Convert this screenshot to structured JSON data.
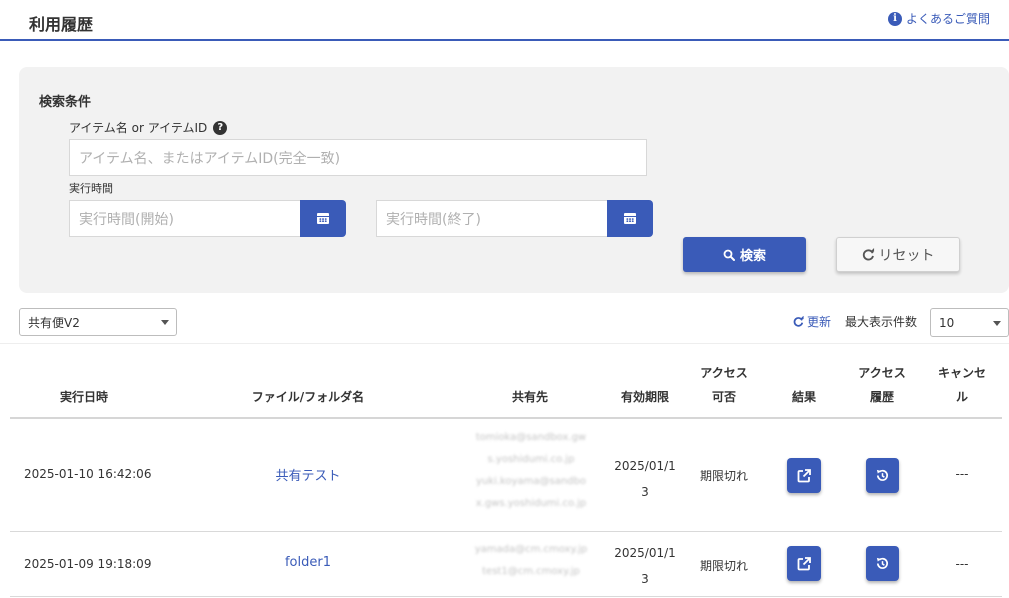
{
  "header": {
    "title": "利用履歴",
    "faq_label": "よくあるご質問"
  },
  "search": {
    "heading": "検索条件",
    "item_label": "アイテム名 or アイテムID",
    "item_placeholder": "アイテム名、またはアイテムID(完全一致)",
    "time_label": "実行時間",
    "start_placeholder": "実行時間(開始)",
    "end_placeholder": "実行時間(終了)",
    "search_button": "検索",
    "reset_button": "リセット"
  },
  "toolbar": {
    "filter_value": "共有便V2",
    "refresh_label": "更新",
    "max_label": "最大表示件数",
    "max_value": "10"
  },
  "table": {
    "headers": {
      "executed_at": "実行日時",
      "name": "ファイル/フォルダ名",
      "share_to": "共有先",
      "expiry": "有効期限",
      "access_1": "アクセス",
      "access_2": "可否",
      "result": "結果",
      "history_1": "アクセス",
      "history_2": "履歴",
      "cancel_1": "キャンセ",
      "cancel_2": "ル"
    },
    "rows": [
      {
        "executed_at": "2025-01-10 16:42:06",
        "name": "共有テスト",
        "share_lines": [
          "tomioka@sandbox.gw",
          "s.yoshidumi.co.jp",
          "yuki.koyama@sandbo",
          "x.gws.yoshidumi.co.jp"
        ],
        "expiry_1": "2025/01/1",
        "expiry_2": "3",
        "access": "期限切れ",
        "cancel": "---"
      },
      {
        "executed_at": "2025-01-09 19:18:09",
        "name": "folder1",
        "share_lines": [
          "yamada@cm.cmoxy.jp",
          "test1@cm.cmoxy.jp"
        ],
        "expiry_1": "2025/01/1",
        "expiry_2": "3",
        "access": "期限切れ",
        "cancel": "---"
      }
    ]
  },
  "colors": {
    "accent": "#3a5bb8",
    "panel_bg": "#f2f2f2"
  }
}
